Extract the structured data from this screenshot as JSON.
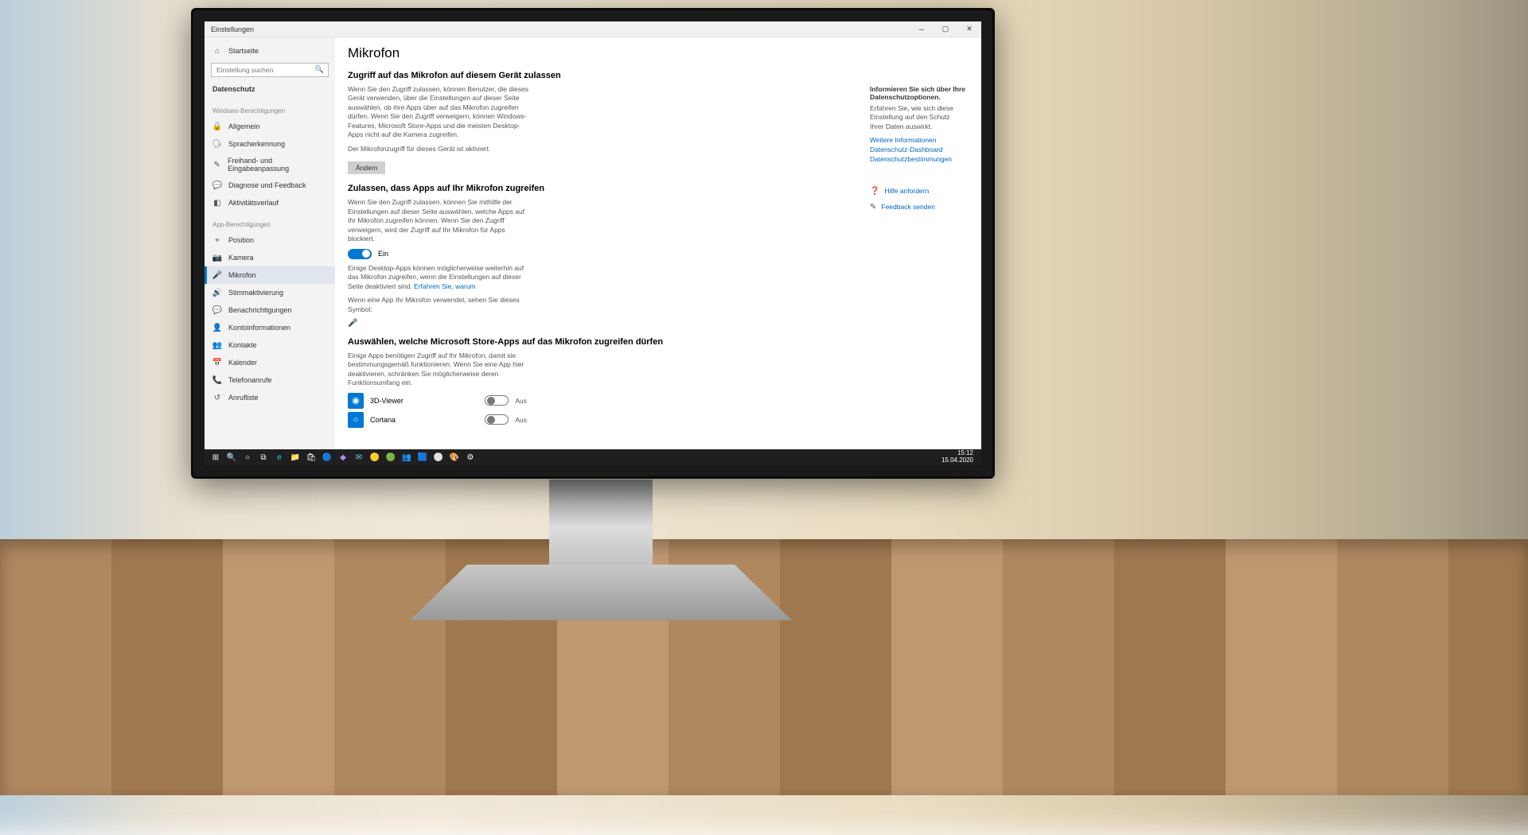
{
  "window": {
    "title": "Einstellungen"
  },
  "sidebar": {
    "home": "Startseite",
    "search_placeholder": "Einstellung suchen",
    "category": "Datenschutz",
    "section1": "Windows-Berechtigungen",
    "items1": [
      {
        "label": "Allgemein"
      },
      {
        "label": "Spracherkennung"
      },
      {
        "label": "Freihand- und Eingabeanpassung"
      },
      {
        "label": "Diagnose und Feedback"
      },
      {
        "label": "Aktivitätsverlauf"
      }
    ],
    "section2": "App-Berechtigungen",
    "items2": [
      {
        "label": "Position"
      },
      {
        "label": "Kamera"
      },
      {
        "label": "Mikrofon"
      },
      {
        "label": "Stimmaktivierung"
      },
      {
        "label": "Benachrichtigungen"
      },
      {
        "label": "Kontoinformationen"
      },
      {
        "label": "Kontakte"
      },
      {
        "label": "Kalender"
      },
      {
        "label": "Telefonanrufe"
      },
      {
        "label": "Anrufliste"
      }
    ]
  },
  "main": {
    "title": "Mikrofon",
    "sec1": {
      "heading": "Zugriff auf das Mikrofon auf diesem Gerät zulassen",
      "desc": "Wenn Sie den Zugriff zulassen, können Benutzer, die dieses Gerät verwenden, über die Einstellungen auf dieser Seite auswählen, ob ihre Apps über auf das Mikrofon zugreifen dürfen. Wenn Sie den Zugriff verweigern, können Windows-Features, Microsoft Store-Apps und die meisten Desktop-Apps nicht auf die Kamera zugreifen.",
      "status": "Der Mikrofonzugriff für dieses Gerät ist aktiviert.",
      "button": "Ändern"
    },
    "sec2": {
      "heading": "Zulassen, dass Apps auf Ihr Mikrofon zugreifen",
      "desc": "Wenn Sie den Zugriff zulassen, können Sie mithilfe der Einstellungen auf dieser Seite auswählen, welche Apps auf Ihr Mikrofon zugreifen können. Wenn Sie den Zugriff verweigern, wird der Zugriff auf Ihr Mikrofon für Apps blockiert.",
      "toggle_state": "Ein",
      "note": "Einige Desktop-Apps können möglicherweise weiterhin auf das Mikrofon zugreifen, wenn die Einstellungen auf dieser Seite deaktiviert sind. ",
      "note_link": "Erfahren Sie, warum",
      "symbol_text": "Wenn eine App Ihr Mikrofon verwendet, sehen Sie dieses Symbol:"
    },
    "sec3": {
      "heading": "Auswählen, welche Microsoft Store-Apps auf das Mikrofon zugreifen dürfen",
      "desc": "Einige Apps benötigen Zugriff auf Ihr Mikrofon, damit sie bestimmungsgemäß funktionieren. Wenn Sie eine App hier deaktivieren, schränken Sie möglicherweise deren Funktionsumfang ein.",
      "apps": [
        {
          "name": "3D-Viewer",
          "state": "Aus",
          "color": "#0078d4"
        },
        {
          "name": "Cortana",
          "state": "Aus",
          "color": "#0078d4"
        }
      ]
    }
  },
  "right": {
    "heading": "Informieren Sie sich über Ihre Datenschutzoptionen.",
    "desc": "Erfahren Sie, wie sich diese Einstellung auf den Schutz Ihrer Daten auswirkt.",
    "links": [
      "Weitere Informationen",
      "Datenschutz-Dashboard",
      "Datenschutzbestimmungen"
    ],
    "help": "Hilfe anfordern",
    "feedback": "Feedback senden"
  },
  "taskbar": {
    "time": "15:12",
    "date": "15.04.2020"
  }
}
